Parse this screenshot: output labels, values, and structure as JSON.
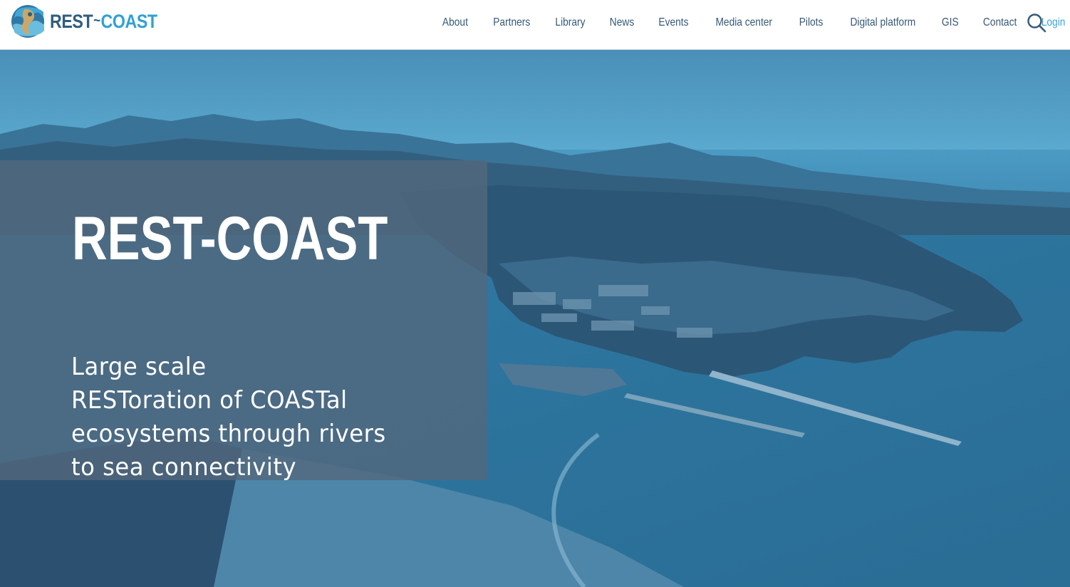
{
  "header": {
    "logo": {
      "part1": "REST",
      "tilde": "~",
      "part2": "COAST"
    },
    "nav": [
      "About",
      "Partners",
      "Library",
      "News",
      "Events",
      "Media center",
      "Pilots",
      "Digital platform",
      "GIS",
      "Contact"
    ],
    "login": "Login",
    "search_icon": "search-icon"
  },
  "hero": {
    "title": "REST-COAST",
    "subtitle_lines": [
      "Large scale",
      "RESToration of COASTal",
      "ecosystems through rivers",
      "to sea connectivity"
    ]
  },
  "colors": {
    "brand_dark": "#2f5d80",
    "brand_light": "#2fa1d6",
    "nav_text": "#35587a",
    "login_text": "#36a8dc",
    "panel_overlay": "#52687d"
  }
}
